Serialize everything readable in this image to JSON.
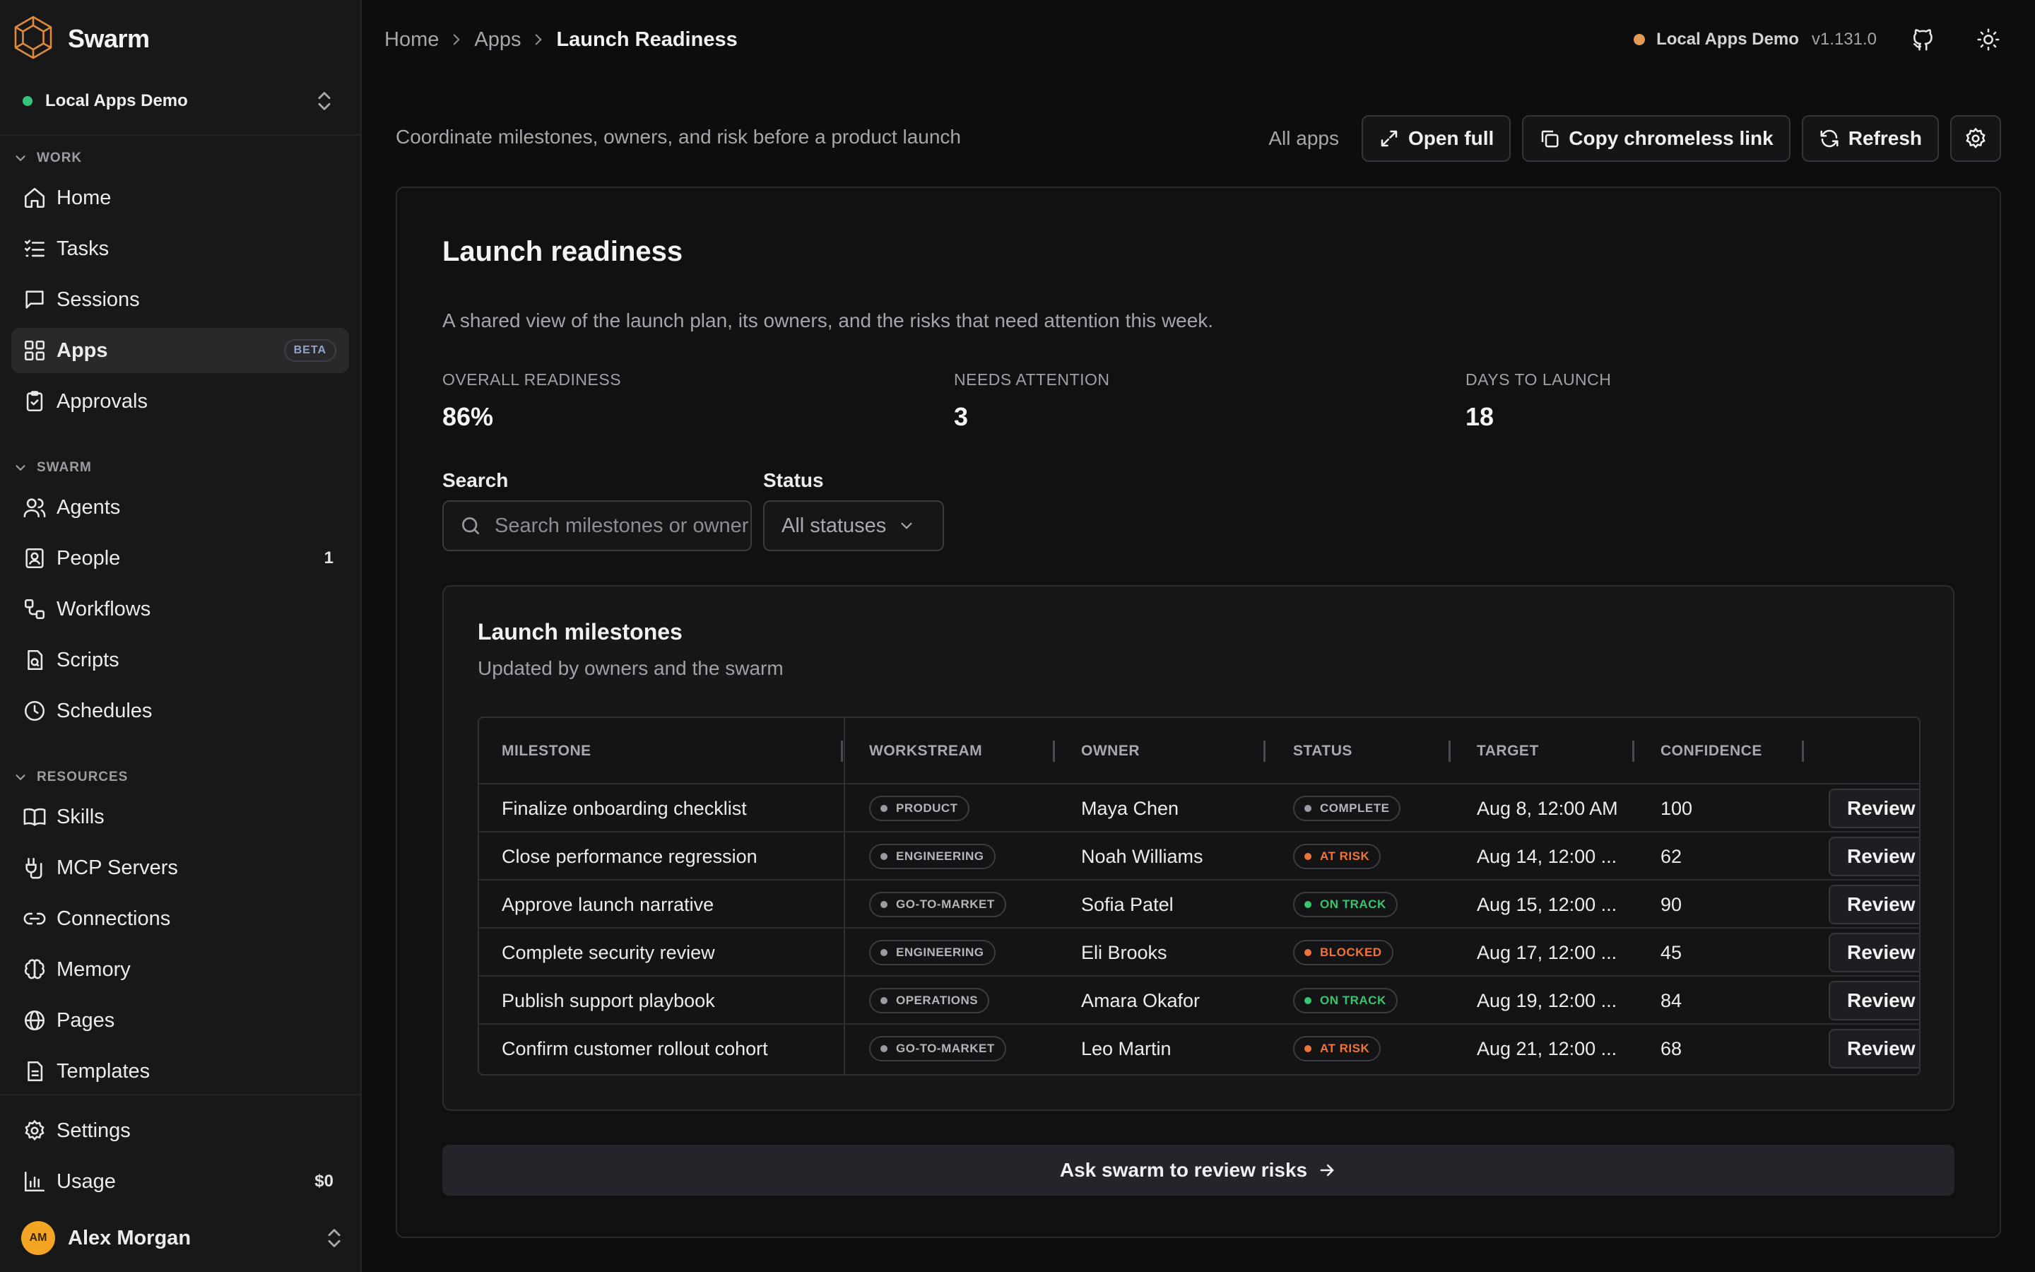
{
  "app": {
    "name": "Swarm"
  },
  "workspace": {
    "name": "Local Apps Demo"
  },
  "sidebar": {
    "sections": [
      {
        "label": "WORK"
      },
      {
        "label": "SWARM"
      },
      {
        "label": "RESOURCES"
      }
    ],
    "work": [
      {
        "label": "Home",
        "icon": "home-icon"
      },
      {
        "label": "Tasks",
        "icon": "tasks-icon"
      },
      {
        "label": "Sessions",
        "icon": "chat-icon"
      },
      {
        "label": "Apps",
        "icon": "grid-icon",
        "badge": "BETA",
        "active": true
      },
      {
        "label": "Approvals",
        "icon": "clipboard-check-icon"
      }
    ],
    "swarm": [
      {
        "label": "Agents",
        "icon": "users-icon"
      },
      {
        "label": "People",
        "icon": "contact-icon",
        "count": "1"
      },
      {
        "label": "Workflows",
        "icon": "workflow-icon"
      },
      {
        "label": "Scripts",
        "icon": "script-icon"
      },
      {
        "label": "Schedules",
        "icon": "clock-icon"
      }
    ],
    "resources": [
      {
        "label": "Skills",
        "icon": "book-icon"
      },
      {
        "label": "MCP Servers",
        "icon": "plug-icon"
      },
      {
        "label": "Connections",
        "icon": "link-icon"
      },
      {
        "label": "Memory",
        "icon": "brain-icon"
      },
      {
        "label": "Pages",
        "icon": "globe-icon"
      },
      {
        "label": "Templates",
        "icon": "file-icon"
      }
    ],
    "footer": [
      {
        "label": "Settings",
        "icon": "gear-icon"
      },
      {
        "label": "Usage",
        "icon": "chart-icon",
        "count": "$0"
      }
    ],
    "user": {
      "initials": "AM",
      "name": "Alex Morgan"
    }
  },
  "topbar": {
    "breadcrumb": [
      "Home",
      "Apps",
      "Launch Readiness"
    ],
    "environment": "Local Apps Demo",
    "version": "v1.131.0"
  },
  "app_header": {
    "description": "Coordinate milestones, owners, and risk before a product launch",
    "all_apps": "All apps",
    "open_full": "Open full",
    "copy_link": "Copy chromeless link",
    "refresh": "Refresh"
  },
  "main": {
    "title": "Launch readiness",
    "subtitle": "A shared view of the launch plan, its owners, and the risks that need attention this week.",
    "stats": [
      {
        "label": "OVERALL READINESS",
        "value": "86%"
      },
      {
        "label": "NEEDS ATTENTION",
        "value": "3"
      },
      {
        "label": "DAYS TO LAUNCH",
        "value": "18"
      }
    ],
    "search": {
      "label": "Search",
      "placeholder": "Search milestones or owners"
    },
    "status_filter": {
      "label": "Status",
      "value": "All statuses"
    },
    "milestones": {
      "title": "Launch milestones",
      "subtitle": "Updated by owners and the swarm",
      "columns": [
        "MILESTONE",
        "WORKSTREAM",
        "OWNER",
        "STATUS",
        "TARGET",
        "CONFIDENCE"
      ],
      "review_label": "Review",
      "rows": [
        {
          "milestone": "Finalize onboarding checklist",
          "workstream": "PRODUCT",
          "owner": "Maya Chen",
          "status": "COMPLETE",
          "status_color": "#9a9aa2",
          "target": "Aug 8, 12:00 AM",
          "confidence": "100"
        },
        {
          "milestone": "Close performance regression",
          "workstream": "ENGINEERING",
          "owner": "Noah Williams",
          "status": "AT RISK",
          "status_color": "#f0733a",
          "target": "Aug 14, 12:00 ...",
          "confidence": "62"
        },
        {
          "milestone": "Approve launch narrative",
          "workstream": "GO-TO-MARKET",
          "owner": "Sofia Patel",
          "status": "ON TRACK",
          "status_color": "#39c46e",
          "target": "Aug 15, 12:00 ...",
          "confidence": "90"
        },
        {
          "milestone": "Complete security review",
          "workstream": "ENGINEERING",
          "owner": "Eli Brooks",
          "status": "BLOCKED",
          "status_color": "#f0733a",
          "target": "Aug 17, 12:00 ...",
          "confidence": "45"
        },
        {
          "milestone": "Publish support playbook",
          "workstream": "OPERATIONS",
          "owner": "Amara Okafor",
          "status": "ON TRACK",
          "status_color": "#39c46e",
          "target": "Aug 19, 12:00 ...",
          "confidence": "84"
        },
        {
          "milestone": "Confirm customer rollout cohort",
          "workstream": "GO-TO-MARKET",
          "owner": "Leo Martin",
          "status": "AT RISK",
          "status_color": "#f0733a",
          "target": "Aug 21, 12:00 ...",
          "confidence": "68"
        }
      ]
    },
    "cta": "Ask swarm to review risks"
  }
}
